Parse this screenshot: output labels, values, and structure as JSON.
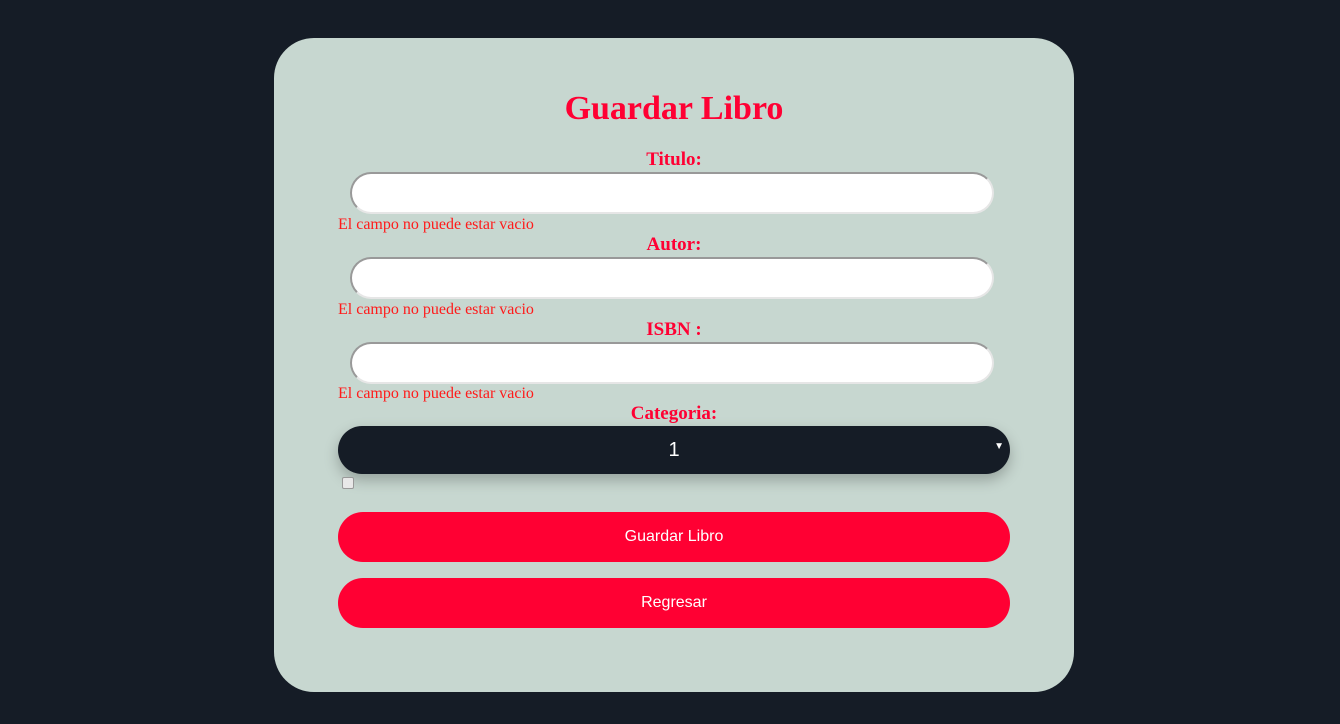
{
  "form": {
    "title": "Guardar Libro",
    "fields": [
      {
        "label": "Titulo:",
        "value": "",
        "error": "El campo no puede estar vacio"
      },
      {
        "label": "Autor:",
        "value": "",
        "error": "El campo no puede estar vacio"
      },
      {
        "label": "ISBN :",
        "value": "",
        "error": "El campo no puede estar vacio"
      }
    ],
    "category": {
      "label": "Categoria:",
      "selected": "1"
    },
    "checkbox_checked": false,
    "save_label": "Guardar Libro",
    "back_label": "Regresar"
  },
  "colors": {
    "accent": "#ff0033",
    "background": "#151c26",
    "card": "#c7d7d0"
  }
}
